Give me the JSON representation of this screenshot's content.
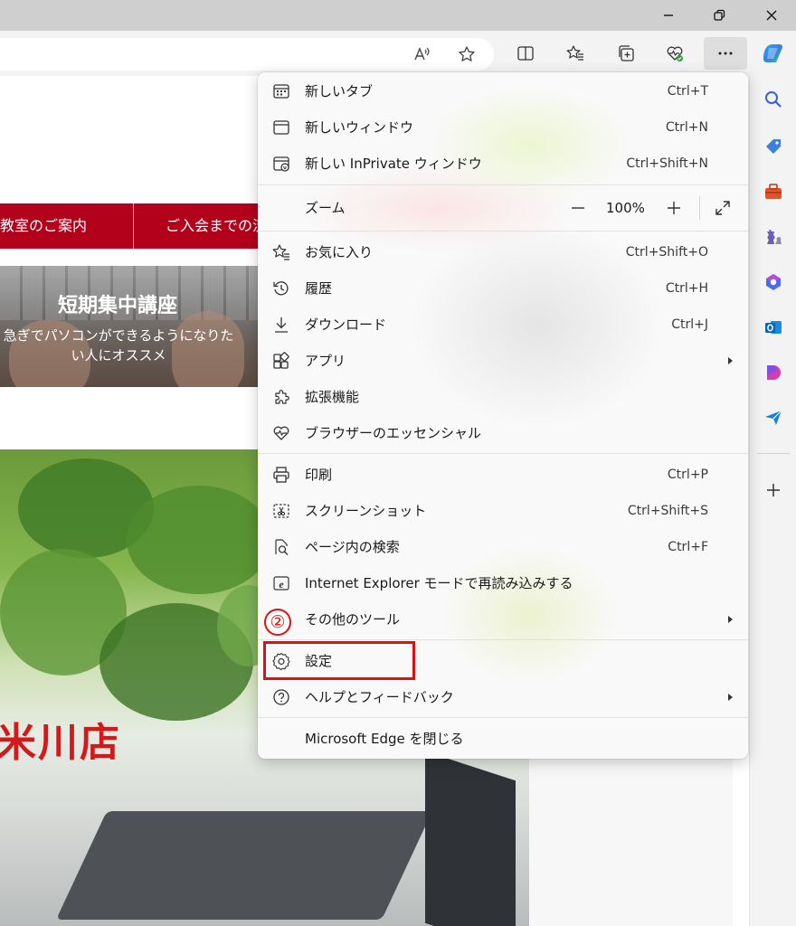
{
  "menu": {
    "items": [
      {
        "label": "新しいタブ",
        "shortcut": "Ctrl+T"
      },
      {
        "label": "新しいウィンドウ",
        "shortcut": "Ctrl+N"
      },
      {
        "label": "新しい InPrivate ウィンドウ",
        "shortcut": "Ctrl+Shift+N"
      },
      {
        "label": "お気に入り",
        "shortcut": "Ctrl+Shift+O"
      },
      {
        "label": "履歴",
        "shortcut": "Ctrl+H"
      },
      {
        "label": "ダウンロード",
        "shortcut": "Ctrl+J"
      },
      {
        "label": "アプリ"
      },
      {
        "label": "拡張機能"
      },
      {
        "label": "ブラウザーのエッセンシャル"
      },
      {
        "label": "印刷",
        "shortcut": "Ctrl+P"
      },
      {
        "label": "スクリーンショット",
        "shortcut": "Ctrl+Shift+S"
      },
      {
        "label": "ページ内の検索",
        "shortcut": "Ctrl+F"
      },
      {
        "label": "Internet Explorer モードで再読み込みする"
      },
      {
        "label": "その他のツール"
      },
      {
        "label": "設定"
      },
      {
        "label": "ヘルプとフィードバック"
      },
      {
        "label": "Microsoft Edge を閉じる"
      }
    ],
    "zoom": {
      "label": "ズーム",
      "value": "100%",
      "minus": "—",
      "plus": "+"
    }
  },
  "annotations": {
    "step": "②",
    "highlight_color": "#e01010"
  },
  "page": {
    "nav": [
      "教室のご案内",
      "ご入会までの流"
    ],
    "banner": {
      "title": "短期集中講座",
      "subtitle_line1": "急ぎでパソコンができるようになりた",
      "subtitle_line2": "い人にオススメ"
    },
    "store_name": "米川店"
  },
  "icons": {
    "titlebar": [
      "minimize-icon",
      "restore-icon",
      "close-icon"
    ],
    "toolbar": [
      "read-aloud-icon",
      "add-favorite-icon",
      "split-screen-icon",
      "favorites-icon",
      "collections-icon",
      "browser-essentials-icon",
      "more-icon",
      "copilot-icon"
    ],
    "sidebar": [
      "search-icon",
      "shopping-icon",
      "tools-icon",
      "games-icon",
      "microsoft365-icon",
      "outlook-icon",
      "designer-icon",
      "drop-icon",
      "add-icon"
    ]
  },
  "colors": {
    "brand_red": "#b3001b",
    "menu_bg": "#f9f9f9",
    "chrome": "#f3f3f3"
  }
}
